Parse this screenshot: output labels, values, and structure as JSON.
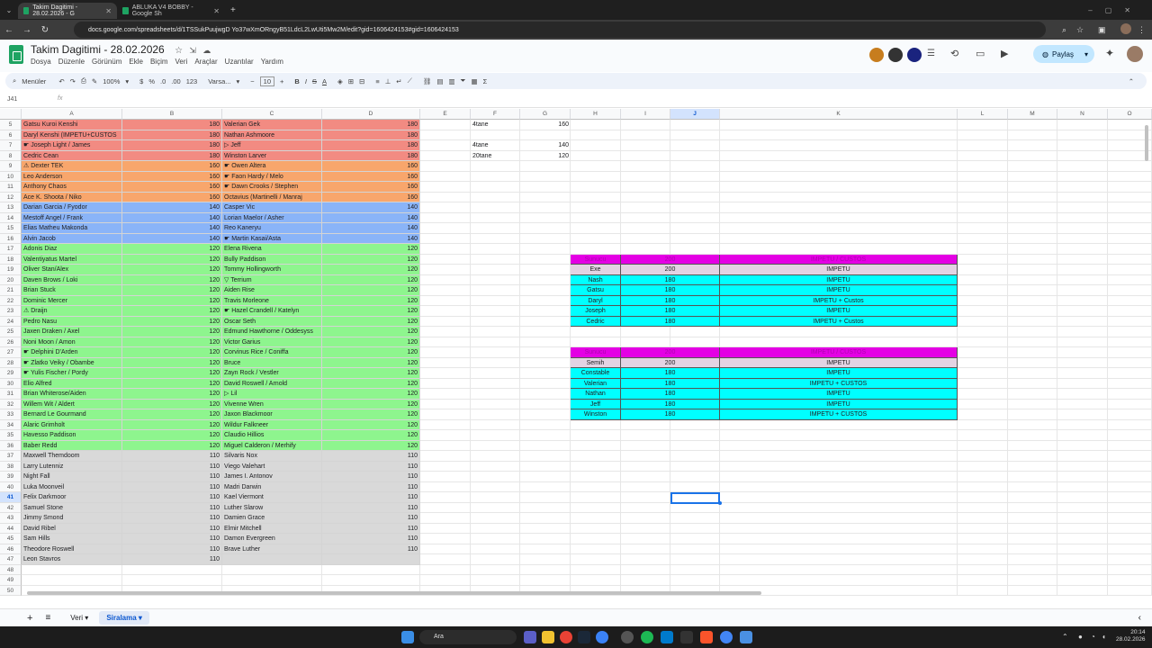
{
  "browser": {
    "tabs": [
      {
        "label": "Takim Dagitimi - 28.02.2026 - G",
        "active": true
      },
      {
        "label": "ABLUKA V4 BOBBY - Google Sh",
        "active": false
      }
    ],
    "url": "docs.google.com/spreadsheets/d/1TSSukPuujwgD Yo37wXmORngyB51LdcL2LwUti5Mw2M/edit?gid=1606424153#gid=1606424153"
  },
  "sheets": {
    "title": "Takim Dagitimi - 28.02.2026",
    "menu": [
      "Dosya",
      "Düzenle",
      "Görünüm",
      "Ekle",
      "Biçim",
      "Veri",
      "Araçlar",
      "Uzantılar",
      "Yardım"
    ],
    "share_label": "Paylaş",
    "toolbar": {
      "search": "Menüler",
      "zoom": "100%",
      "currency": "$",
      "percent": "%",
      "decimals_dec": ".0",
      "decimals_inc": ".00",
      "format123": "123",
      "font": "Varsa...",
      "font_size": "10"
    },
    "cell_ref": "J41",
    "fx": "fx"
  },
  "columns": [
    "A",
    "B",
    "C",
    "D",
    "E",
    "F",
    "G",
    "H",
    "I",
    "J",
    "K",
    "L",
    "M",
    "N",
    "O"
  ],
  "rows": [
    {
      "n": "5",
      "a": "Gatsu Kuroi Kenshi",
      "b": "180",
      "c": "Valerian Gek",
      "d": "180",
      "color": "#f28b82"
    },
    {
      "n": "6",
      "a": "Daryl Kenshi (IMPETU+CUSTOS",
      "b": "180",
      "c": "Nathan Ashmoore",
      "d": "180",
      "color": "#f28b82"
    },
    {
      "n": "7",
      "a": "☛ Joseph Light / James",
      "b": "180",
      "c": "▷ Jeff",
      "d": "180",
      "color": "#f28b82"
    },
    {
      "n": "8",
      "a": "Cedric Cean",
      "b": "180",
      "c": "Winston Larver",
      "d": "180",
      "color": "#f28b82"
    },
    {
      "n": "9",
      "a": "⚠ Dexter TEK",
      "b": "160",
      "c": "☛ Owen Altera",
      "d": "160",
      "color": "#f8a66c"
    },
    {
      "n": "10",
      "a": "Leo Anderson",
      "b": "160",
      "c": "☛ Faon Hardy / Melo",
      "d": "160",
      "color": "#f8a66c"
    },
    {
      "n": "11",
      "a": "Anthony Chaos",
      "b": "160",
      "c": "☛ Dawn Crooks / Stephen",
      "d": "160",
      "color": "#f8a66c"
    },
    {
      "n": "12",
      "a": "Ace K. Shoota / Niko",
      "b": "160",
      "c": "Octavius (Martinelli / Manraj",
      "d": "160",
      "color": "#f8a66c"
    },
    {
      "n": "13",
      "a": "Darian Garcia / Fyodor",
      "b": "140",
      "c": "Casper Vic",
      "d": "140",
      "color": "#8ab4f8"
    },
    {
      "n": "14",
      "a": "Mestoff Angel / Frank",
      "b": "140",
      "c": "Lorian Maelor / Asher",
      "d": "140",
      "color": "#8ab4f8"
    },
    {
      "n": "15",
      "a": "Elias Matheu Makonda",
      "b": "140",
      "c": "Reo Kaneryu",
      "d": "140",
      "color": "#8ab4f8"
    },
    {
      "n": "16",
      "a": "Alvin Jacob",
      "b": "140",
      "c": "☛ Martin Kasai/Asta",
      "d": "140",
      "color": "#8ab4f8"
    },
    {
      "n": "17",
      "a": "Adonis Diaz",
      "b": "120",
      "c": "Elena Rivena",
      "d": "120",
      "color": "#8ef58e"
    },
    {
      "n": "18",
      "a": "Valentiyatus Martel",
      "b": "120",
      "c": "Bully Paddison",
      "d": "120",
      "color": "#8ef58e"
    },
    {
      "n": "19",
      "a": "Oliver Stan/Alex",
      "b": "120",
      "c": "Tommy Hollingworth",
      "d": "120",
      "color": "#8ef58e"
    },
    {
      "n": "20",
      "a": "Daven Brows / Loki",
      "b": "120",
      "c": "▽ Terrium",
      "d": "120",
      "color": "#8ef58e"
    },
    {
      "n": "21",
      "a": "Brian Stuck",
      "b": "120",
      "c": "Aiden Rise",
      "d": "120",
      "color": "#8ef58e"
    },
    {
      "n": "22",
      "a": "Dominic Mercer",
      "b": "120",
      "c": "Travis Morleone",
      "d": "120",
      "color": "#8ef58e"
    },
    {
      "n": "23",
      "a": "⚠ Draijn",
      "b": "120",
      "c": "☛ Hazel Crandell / Katelyn",
      "d": "120",
      "color": "#8ef58e"
    },
    {
      "n": "24",
      "a": "Pedro Nasu",
      "b": "120",
      "c": "Oscar Seth",
      "d": "120",
      "color": "#8ef58e"
    },
    {
      "n": "25",
      "a": "Jaxen Draken / Axel",
      "b": "120",
      "c": "Edmund Hawthorne / Oddesyss",
      "d": "120",
      "color": "#8ef58e"
    },
    {
      "n": "26",
      "a": "Noni Moon / Amon",
      "b": "120",
      "c": "Victor Garius",
      "d": "120",
      "color": "#8ef58e"
    },
    {
      "n": "27",
      "a": "☛ Delphini D'Arden",
      "b": "120",
      "c": "Corvinus Rice / Coniffa",
      "d": "120",
      "color": "#8ef58e"
    },
    {
      "n": "28",
      "a": "☛ Zlatko Veiky / Obambe",
      "b": "120",
      "c": "Bruce",
      "d": "120",
      "color": "#8ef58e"
    },
    {
      "n": "29",
      "a": "☛ Yulis Fischer / Pordy",
      "b": "120",
      "c": "Zayn Rock / Vestler",
      "d": "120",
      "color": "#8ef58e"
    },
    {
      "n": "30",
      "a": "Elio Alfred",
      "b": "120",
      "c": "David Roswell / Arnold",
      "d": "120",
      "color": "#8ef58e"
    },
    {
      "n": "31",
      "a": "Brian Whiterose/Aiden",
      "b": "120",
      "c": "▷ Lil",
      "d": "120",
      "color": "#8ef58e"
    },
    {
      "n": "32",
      "a": "Willem Wit / Aldert",
      "b": "120",
      "c": "Vivenne Wren",
      "d": "120",
      "color": "#8ef58e"
    },
    {
      "n": "33",
      "a": "Bernard Le Gourmand",
      "b": "120",
      "c": "Jaxon Blackmoor",
      "d": "120",
      "color": "#8ef58e"
    },
    {
      "n": "34",
      "a": "Alaric Grimholt",
      "b": "120",
      "c": "Wildur Falkneer",
      "d": "120",
      "color": "#8ef58e"
    },
    {
      "n": "35",
      "a": "Havesso Paddison",
      "b": "120",
      "c": "Claudio Hillios",
      "d": "120",
      "color": "#8ef58e"
    },
    {
      "n": "36",
      "a": "Baber Redd",
      "b": "120",
      "c": "Miguel Calderon / Merhify",
      "d": "120",
      "color": "#8ef58e"
    },
    {
      "n": "37",
      "a": "Maxwell Themdoom",
      "b": "110",
      "c": "Silvaris Nox",
      "d": "110",
      "color": "#d9d9d9"
    },
    {
      "n": "38",
      "a": "Larry Lutenniz",
      "b": "110",
      "c": "Viego Valehart",
      "d": "110",
      "color": "#d9d9d9"
    },
    {
      "n": "39",
      "a": "Night Fall",
      "b": "110",
      "c": "James I. Antonov",
      "d": "110",
      "color": "#d9d9d9"
    },
    {
      "n": "40",
      "a": "Luka Moonveil",
      "b": "110",
      "c": "Madri Darwin",
      "d": "110",
      "color": "#d9d9d9"
    },
    {
      "n": "41",
      "a": "Felix Darkmoor",
      "b": "110",
      "c": "Kael Viermont",
      "d": "110",
      "color": "#d9d9d9"
    },
    {
      "n": "42",
      "a": "Samuel Stone",
      "b": "110",
      "c": "Luther Slarow",
      "d": "110",
      "color": "#d9d9d9"
    },
    {
      "n": "43",
      "a": "Jimmy Smond",
      "b": "110",
      "c": "Damien Grace",
      "d": "110",
      "color": "#d9d9d9"
    },
    {
      "n": "44",
      "a": "David Ribel",
      "b": "110",
      "c": "Elmir Mitchell",
      "d": "110",
      "color": "#d9d9d9"
    },
    {
      "n": "45",
      "a": "Sam Hills",
      "b": "110",
      "c": "Damon Evergreen",
      "d": "110",
      "color": "#d9d9d9"
    },
    {
      "n": "46",
      "a": "Theodore Roswell",
      "b": "110",
      "c": "Brave Luther",
      "d": "110",
      "color": "#d9d9d9"
    },
    {
      "n": "47",
      "a": "Leon Stavros",
      "b": "110",
      "c": "",
      "d": "",
      "color": "#d9d9d9"
    },
    {
      "n": "48",
      "a": "",
      "b": "",
      "c": "",
      "d": "",
      "color": ""
    },
    {
      "n": "49",
      "a": "",
      "b": "",
      "c": "",
      "d": "",
      "color": ""
    },
    {
      "n": "50",
      "a": "",
      "b": "",
      "c": "",
      "d": "",
      "color": ""
    }
  ],
  "side_values": [
    {
      "label": "4tane",
      "value": "160"
    },
    {
      "label": "",
      "value": ""
    },
    {
      "label": "4tane",
      "value": "140"
    },
    {
      "label": "20tane",
      "value": "120"
    }
  ],
  "table1": {
    "header": [
      "Sunucu",
      "200",
      "IMPETU / CUSTOS"
    ],
    "rows": [
      [
        "Exe",
        "200",
        "IMPETU"
      ],
      [
        "Nash",
        "180",
        "IMPETU"
      ],
      [
        "Gatsu",
        "180",
        "IMPETU"
      ],
      [
        "Daryl",
        "180",
        "IMPETU + Custos"
      ],
      [
        "Joseph",
        "180",
        "IMPETU"
      ],
      [
        "Cedric",
        "180",
        "IMPETU + Custos"
      ]
    ]
  },
  "table2": {
    "header": [
      "Sunucu",
      "200",
      "IMPETU / CUSTOS"
    ],
    "rows": [
      [
        "Semih",
        "200",
        "IMPETU"
      ],
      [
        "Constable",
        "180",
        "IMPETU"
      ],
      [
        "Valerian",
        "180",
        "IMPETU + CUSTOS"
      ],
      [
        "Nathan",
        "180",
        "IMPETU"
      ],
      [
        "Jeff",
        "180",
        "IMPETU"
      ],
      [
        "Winston",
        "180",
        "IMPETU + CUSTOS"
      ]
    ]
  },
  "sheet_tabs": [
    {
      "label": "Veri",
      "active": false
    },
    {
      "label": "Siralama",
      "active": true
    }
  ],
  "taskbar": {
    "search": "Ara",
    "time": "20:14",
    "date": "28.02.2026"
  },
  "colors": {
    "header_magenta": "#e400e4",
    "first_row": "#e3d3e3",
    "cyan": "#00ffff",
    "red": "#f28b82",
    "orange": "#f8a66c",
    "blue": "#8ab4f8",
    "green": "#8ef58e",
    "gray": "#d9d9d9"
  }
}
